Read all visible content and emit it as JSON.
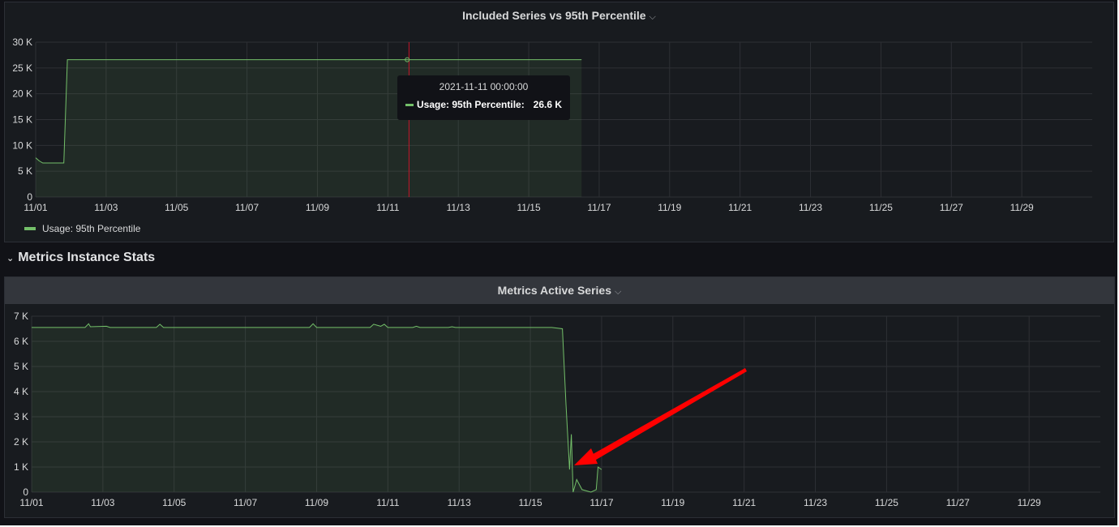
{
  "row": {
    "title": "Metrics Instance Stats"
  },
  "panels": [
    {
      "title": "Included Series vs 95th Percentile",
      "legend": [
        {
          "name": "Usage: 95th Percentile",
          "color": "#73bf69"
        }
      ],
      "tooltip": {
        "time": "2021-11-11 00:00:00",
        "series": "Usage: 95th Percentile:",
        "value": "26.6 K"
      }
    },
    {
      "title": "Metrics Active Series"
    }
  ],
  "chart_data": [
    {
      "type": "area",
      "title": "Included Series vs 95th Percentile",
      "series": [
        {
          "name": "Usage: 95th Percentile",
          "color": "#73bf69",
          "points": [
            [
              0,
              7600
            ],
            [
              0.1,
              7000
            ],
            [
              0.2,
              6600
            ],
            [
              0.8,
              6600
            ],
            [
              0.9,
              26600
            ],
            [
              15.5,
              26600
            ]
          ]
        }
      ],
      "xlim": [
        0,
        30
      ],
      "ylim": [
        0,
        30000
      ],
      "x_ticks": [
        "11/01",
        "11/03",
        "11/05",
        "11/07",
        "11/09",
        "11/11",
        "11/13",
        "11/15",
        "11/17",
        "11/19",
        "11/21",
        "11/23",
        "11/25",
        "11/27",
        "11/29"
      ],
      "y_ticks": [
        "0",
        "5 K",
        "10 K",
        "15 K",
        "20 K",
        "25 K",
        "30 K"
      ],
      "y_tick_values": [
        0,
        5000,
        10000,
        15000,
        20000,
        25000,
        30000
      ],
      "grid": true,
      "legend_position": "bottom-left",
      "hover_x": 10.6
    },
    {
      "type": "area",
      "title": "Metrics Active Series",
      "series": [
        {
          "color": "#73bf69",
          "points": [
            [
              0,
              6550
            ],
            [
              1.5,
              6550
            ],
            [
              1.6,
              6700
            ],
            [
              1.65,
              6580
            ],
            [
              2.1,
              6600
            ],
            [
              2.2,
              6550
            ],
            [
              3.5,
              6550
            ],
            [
              3.6,
              6680
            ],
            [
              3.7,
              6550
            ],
            [
              7.8,
              6550
            ],
            [
              7.9,
              6700
            ],
            [
              8.0,
              6550
            ],
            [
              9.5,
              6550
            ],
            [
              9.6,
              6680
            ],
            [
              9.8,
              6600
            ],
            [
              9.9,
              6680
            ],
            [
              10.0,
              6550
            ],
            [
              10.7,
              6550
            ],
            [
              10.8,
              6600
            ],
            [
              10.9,
              6550
            ],
            [
              11.7,
              6550
            ],
            [
              11.8,
              6580
            ],
            [
              11.9,
              6550
            ],
            [
              14.6,
              6550
            ],
            [
              14.9,
              6500
            ],
            [
              15.0,
              3500
            ],
            [
              15.1,
              900
            ],
            [
              15.15,
              2300
            ],
            [
              15.2,
              0
            ],
            [
              15.3,
              500
            ],
            [
              15.45,
              100
            ],
            [
              15.7,
              0
            ],
            [
              15.85,
              100
            ],
            [
              15.9,
              1000
            ],
            [
              16.0,
              900
            ]
          ]
        }
      ],
      "xlim": [
        0,
        30
      ],
      "ylim": [
        0,
        7000
      ],
      "x_ticks": [
        "11/01",
        "11/03",
        "11/05",
        "11/07",
        "11/09",
        "11/11",
        "11/13",
        "11/15",
        "11/17",
        "11/19",
        "11/21",
        "11/23",
        "11/25",
        "11/27",
        "11/29"
      ],
      "y_ticks": [
        "0",
        "1 K",
        "2 K",
        "3 K",
        "4 K",
        "5 K",
        "6 K",
        "7 K"
      ],
      "y_tick_values": [
        0,
        1000,
        2000,
        3000,
        4000,
        5000,
        6000,
        7000
      ],
      "grid": true,
      "annotation": {
        "type": "arrow",
        "color": "#ff0000"
      }
    }
  ]
}
